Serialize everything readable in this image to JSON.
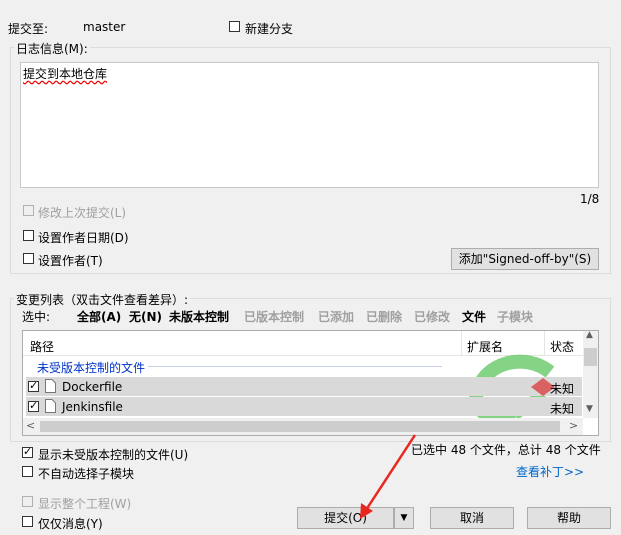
{
  "commit_to": {
    "label": "提交至:",
    "branch": "master"
  },
  "new_branch": {
    "label": "新建分支",
    "checked": false
  },
  "log": {
    "group_label": "日志信息(M):",
    "message": "提交到本地仓库",
    "page_indicator": "1/8"
  },
  "options": {
    "amend_label": "修改上次提交(L)",
    "set_date_label": "设置作者日期(D)",
    "set_author_label": "设置作者(T)",
    "signoff_button": "添加\"Signed-off-by\"(S)"
  },
  "changes": {
    "group_label": "变更列表（双击文件查看差异）:",
    "select_label": "选中:",
    "filters": [
      "全部(A)",
      "无(N)",
      "未版本控制",
      "已版本控制",
      "已添加",
      "已删除",
      "已修改",
      "文件",
      "子模块"
    ],
    "columns": {
      "path": "路径",
      "ext": "扩展名",
      "status": "状态"
    },
    "group_header": "未受版本控制的文件",
    "files": [
      {
        "name": "Dockerfile",
        "status": "未知",
        "checked": true
      },
      {
        "name": "Jenkinsfile",
        "status": "未知",
        "checked": true
      }
    ]
  },
  "bottom": {
    "show_unversioned": "显示未受版本控制的文件(U)",
    "no_auto_submodule": "不自动选择子模块",
    "summary": "已选中 48 个文件，总计 48 个文件",
    "view_patch": "查看补丁>>",
    "show_whole_project": "显示整个工程(W)",
    "message_only": "仅仅消息(Y)"
  },
  "buttons": {
    "commit": "提交(O)",
    "cancel": "取消",
    "help": "帮助"
  },
  "colors": {
    "group_header": "#0033cc",
    "link": "#0066cc",
    "arrow": "#e8281f"
  }
}
